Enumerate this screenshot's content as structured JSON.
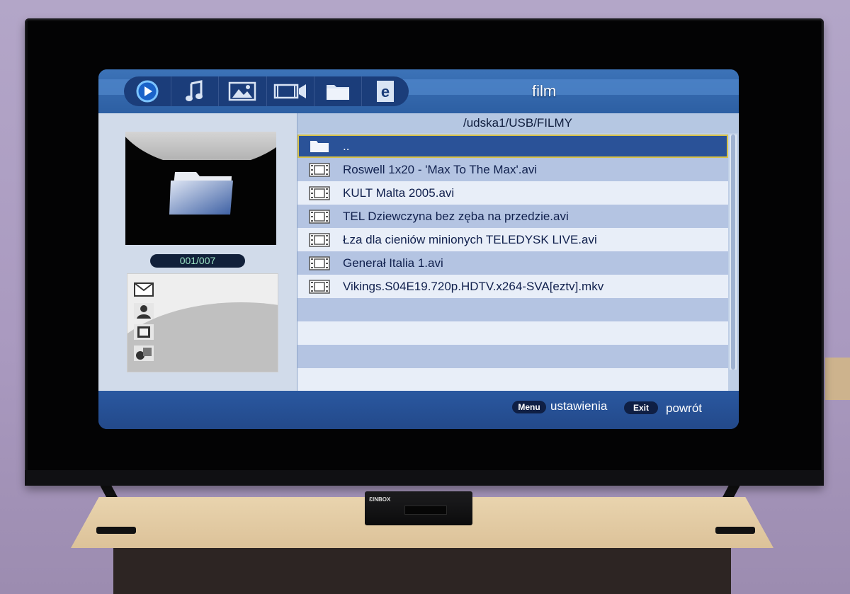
{
  "header": {
    "title": "film",
    "tabs": [
      {
        "icon": "play-icon"
      },
      {
        "icon": "music-note-icon"
      },
      {
        "icon": "photo-icon"
      },
      {
        "icon": "video-camera-icon"
      },
      {
        "icon": "folder-icon"
      },
      {
        "icon": "e-book-icon"
      }
    ]
  },
  "sidebar": {
    "counter": "001/007",
    "info_icons": [
      "mail-icon",
      "person-icon",
      "film-frame-icon",
      "shapes-icon"
    ]
  },
  "browser": {
    "path": "/udska1/USB/FILMY",
    "files": [
      {
        "name": "..",
        "icon": "folder-icon",
        "selected": true
      },
      {
        "name": "Roswell 1x20 - 'Max To The Max'.avi",
        "icon": "film-strip-icon"
      },
      {
        "name": "KULT Malta 2005.avi",
        "icon": "film-strip-icon"
      },
      {
        "name": "TEL Dziewczyna bez zęba na przedzie.avi",
        "icon": "film-strip-icon"
      },
      {
        "name": "Łza dla cieniów minionych TELEDYSK LIVE.avi",
        "icon": "film-strip-icon"
      },
      {
        "name": "Generał Italia 1.avi",
        "icon": "film-strip-icon"
      },
      {
        "name": "Vikings.S04E19.720p.HDTV.x264-SVA[eztv].mkv",
        "icon": "film-strip-icon"
      }
    ]
  },
  "footer": {
    "menu_key": "Menu",
    "menu_label": "ustawienia",
    "exit_key": "Exit",
    "exit_label": "powrót"
  },
  "device": {
    "brand": "ƐINBOX"
  },
  "colors": {
    "panel_blue": "#2b5a9c",
    "row_light": "#e8eef8",
    "row_blue": "#b4c4e2",
    "selection_border": "#d7c24a",
    "counter_text": "#9ce3c4"
  }
}
